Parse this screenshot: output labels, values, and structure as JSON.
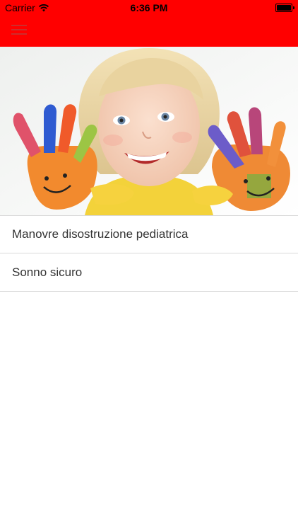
{
  "status_bar": {
    "carrier": "Carrier",
    "time": "6:36 PM"
  },
  "header": {
    "menu_icon": "hamburger-menu-icon",
    "background_color": "#ff0000"
  },
  "hero": {
    "image": "child-with-painted-hands"
  },
  "menu": {
    "items": [
      {
        "label": "Manovre disostruzione pediatrica"
      },
      {
        "label": "Sonno sicuro"
      }
    ]
  }
}
